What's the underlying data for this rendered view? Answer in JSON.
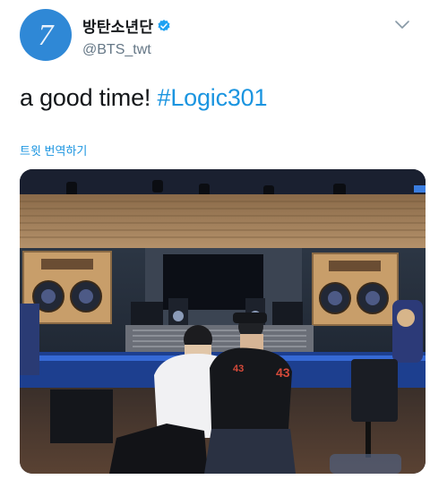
{
  "user": {
    "avatar_text": "7",
    "display_name": "방탄소년단",
    "handle": "@BTS_twt",
    "verified": true
  },
  "tweet": {
    "text": "a good time! ",
    "hashtag": "#Logic301",
    "translate_label": "트윗 번역하기"
  },
  "icons": {
    "verified": "verified-badge-icon",
    "menu": "chevron-down-icon"
  },
  "colors": {
    "link": "#1b95e0",
    "avatar_bg": "#2f88d6",
    "verified": "#1da1f2"
  },
  "photo": {
    "shirt_number_left": "43",
    "shirt_number_right": "43"
  }
}
